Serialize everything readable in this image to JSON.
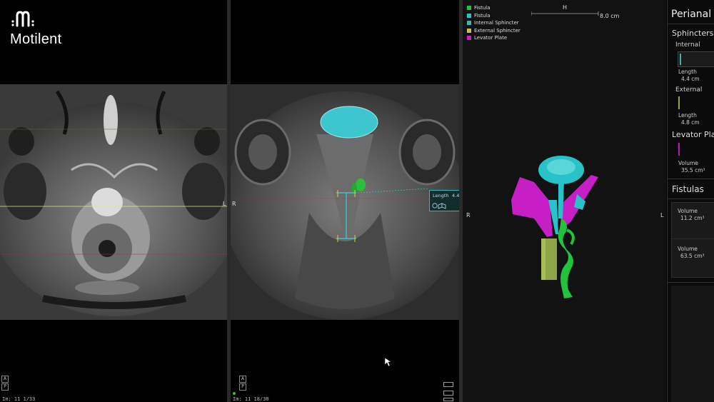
{
  "brand": {
    "name": "Motilent"
  },
  "viewports": {
    "left": {
      "orient_right": "L",
      "footer_text": "Im: 11 1/33",
      "box1": "A",
      "box2": "P"
    },
    "middle": {
      "orient_left": "R",
      "footer_text": "Im: 11 18/30",
      "box1": "A",
      "box2": "P",
      "tooltip": {
        "label": "Length",
        "value": "4.4"
      }
    },
    "render3d": {
      "legend": [
        {
          "label": "Fistula",
          "color": "#22c33a"
        },
        {
          "label": "Fistula",
          "color": "#28c3c9"
        },
        {
          "label": "Internal Sphincter",
          "color": "#3ab5b5"
        },
        {
          "label": "External Sphincter",
          "color": "#c9c23a"
        },
        {
          "label": "Levator Plate",
          "color": "#c51fc5"
        }
      ],
      "ruler_top": "H",
      "ruler_scale": "8.0 cm",
      "orient_left": "R",
      "orient_right": "L"
    }
  },
  "panel": {
    "title": "Perianal A",
    "sphincters": {
      "title": "Sphincters",
      "internal": {
        "label": "Internal",
        "length_label": "Length",
        "length_value": "4.4 cm",
        "color": "#3ab5b5"
      },
      "external": {
        "label": "External",
        "length_label": "Length",
        "length_value": "4.8 cm",
        "color": "#9aa83a"
      }
    },
    "levator": {
      "title": "Levator Pla",
      "volume_label": "Volume",
      "volume_value": "35.5 cm³",
      "color": "#b01fb0"
    },
    "fistulas": {
      "title": "Fistulas",
      "items": [
        {
          "volume_label": "Volume",
          "volume_value": "11.2 cm³"
        },
        {
          "volume_label": "Volume",
          "volume_value": "63.5 cm³"
        }
      ]
    }
  }
}
